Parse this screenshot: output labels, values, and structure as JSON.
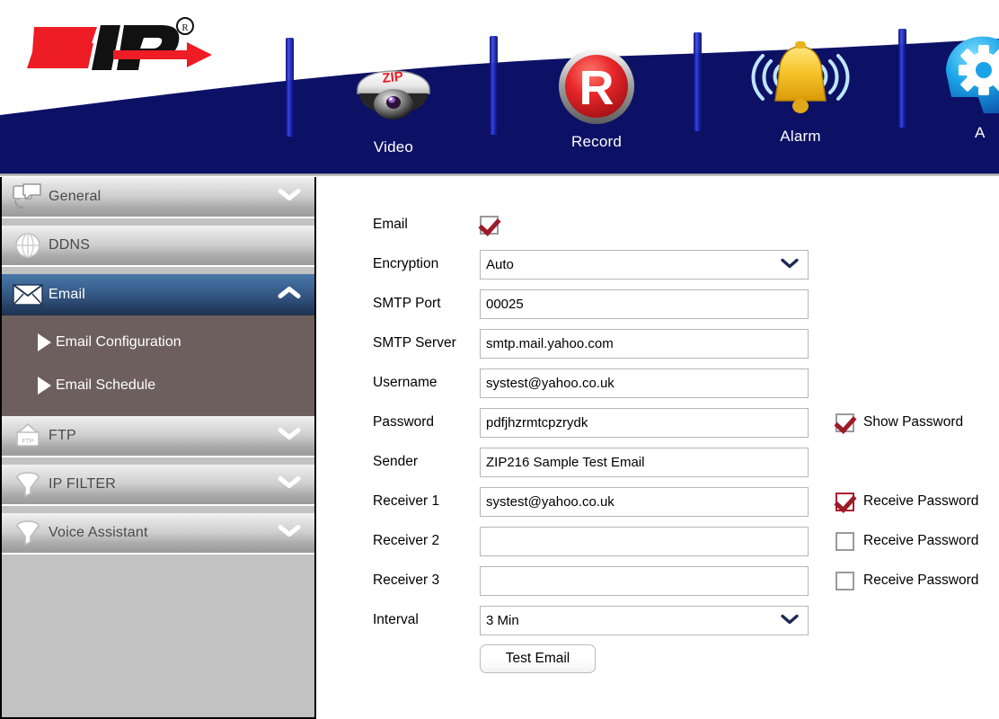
{
  "brand": {
    "logo_text": "ZIP",
    "logo_registered": "®"
  },
  "header": {
    "nav": [
      {
        "label": "Video",
        "icon": "dome-camera-icon"
      },
      {
        "label": "Record",
        "icon": "record-r-icon"
      },
      {
        "label": "Alarm",
        "icon": "alarm-bell-icon"
      },
      {
        "label": "A",
        "icon": "ai-head-gear-icon"
      }
    ],
    "banner_color": "#0d1166",
    "label_color": "#ffffff"
  },
  "sidebar": {
    "items": [
      {
        "label": "General",
        "icon": "monitor-icon",
        "state": "collapsed",
        "chevron": "chevron-down-icon"
      },
      {
        "label": "DDNS",
        "icon": "globe-icon",
        "state": "plain",
        "chevron": ""
      },
      {
        "label": "Email",
        "icon": "envelope-icon",
        "state": "expanded",
        "chevron": "chevron-up-icon",
        "active": true
      },
      {
        "label": "FTP",
        "icon": "ftp-folder-icon",
        "state": "collapsed",
        "chevron": "chevron-down-icon"
      },
      {
        "label": "IP FILTER",
        "icon": "funnel-icon",
        "state": "collapsed",
        "chevron": "chevron-down-icon"
      },
      {
        "label": "Voice Assistant",
        "icon": "funnel-icon",
        "state": "collapsed",
        "chevron": "chevron-down-icon"
      }
    ],
    "submenu": [
      {
        "label": "Email Configuration",
        "icon": "play-triangle-icon"
      },
      {
        "label": "Email Schedule",
        "icon": "play-triangle-icon"
      }
    ],
    "active_color": "#2f4f78",
    "submenu_color": "#6d5f5e"
  },
  "form": {
    "rows": [
      {
        "label": "Email",
        "type": "checkbox",
        "checked": true
      },
      {
        "label": "Encryption",
        "type": "select",
        "value": "Auto"
      },
      {
        "label": "SMTP Port",
        "type": "text",
        "value": "00025",
        "placeholder": ""
      },
      {
        "label": "SMTP Server",
        "type": "text",
        "value": "smtp.mail.yahoo.com",
        "placeholder": ""
      },
      {
        "label": "Username",
        "type": "text",
        "value": "systest@yahoo.co.uk",
        "placeholder": ""
      },
      {
        "label": "Password",
        "type": "text",
        "value": "pdfjhzrmtcpzrydk",
        "placeholder": ""
      },
      {
        "label": "Sender",
        "type": "text",
        "value": "ZIP216 Sample Test Email",
        "placeholder": ""
      },
      {
        "label": "Receiver 1",
        "type": "text",
        "value": "systest@yahoo.co.uk",
        "placeholder": ""
      },
      {
        "label": "Receiver 2",
        "type": "text",
        "value": "",
        "placeholder": ""
      },
      {
        "label": "Receiver 3",
        "type": "text",
        "value": "",
        "placeholder": ""
      },
      {
        "label": "Interval",
        "type": "select",
        "value": "3 Min"
      }
    ],
    "side_checks": [
      {
        "label": "Show Password",
        "checked": true,
        "row": 5
      },
      {
        "label": "Receive Password",
        "checked": true,
        "row": 7
      },
      {
        "label": "Receive Password",
        "checked": false,
        "row": 8
      },
      {
        "label": "Receive Password",
        "checked": false,
        "row": 9
      }
    ],
    "test_button": "Test Email",
    "check_color": "#9c1b27"
  }
}
